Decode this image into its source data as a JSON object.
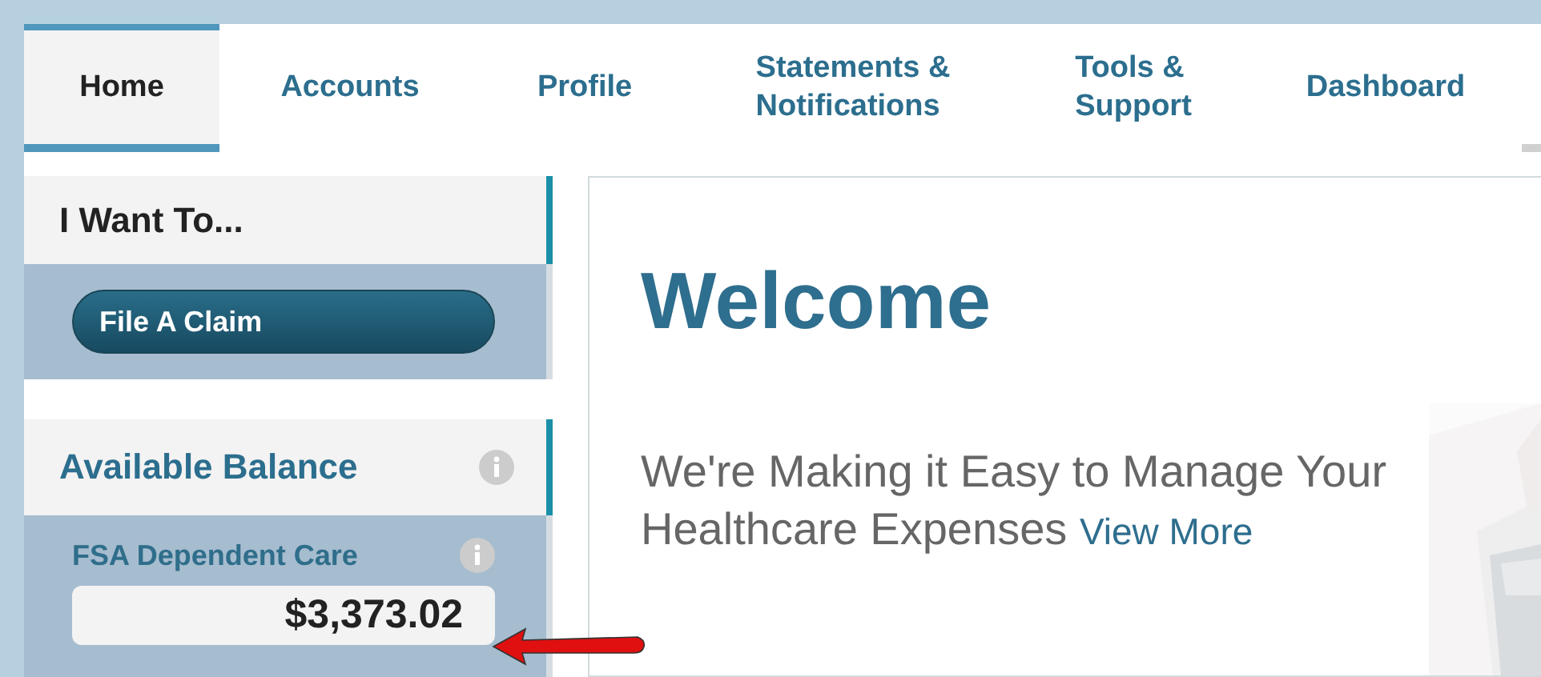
{
  "nav": {
    "tabs": [
      {
        "label": "Home",
        "selected": true
      },
      {
        "label": "Accounts",
        "selected": false
      },
      {
        "label": "Profile",
        "selected": false
      },
      {
        "label": "Statements &\nNotifications",
        "selected": false
      },
      {
        "label": "Tools &\nSupport",
        "selected": false
      },
      {
        "label": "Dashboard",
        "selected": false
      }
    ]
  },
  "sidebar": {
    "actions": {
      "title": "I Want To...",
      "button": "File A Claim"
    },
    "balance": {
      "title": "Available Balance",
      "account": "FSA Dependent Care",
      "amount": "$3,373.02"
    }
  },
  "main": {
    "title": "Welcome",
    "text": "We're Making it Easy to Manage Your Healthcare Expenses",
    "link": "View More"
  }
}
